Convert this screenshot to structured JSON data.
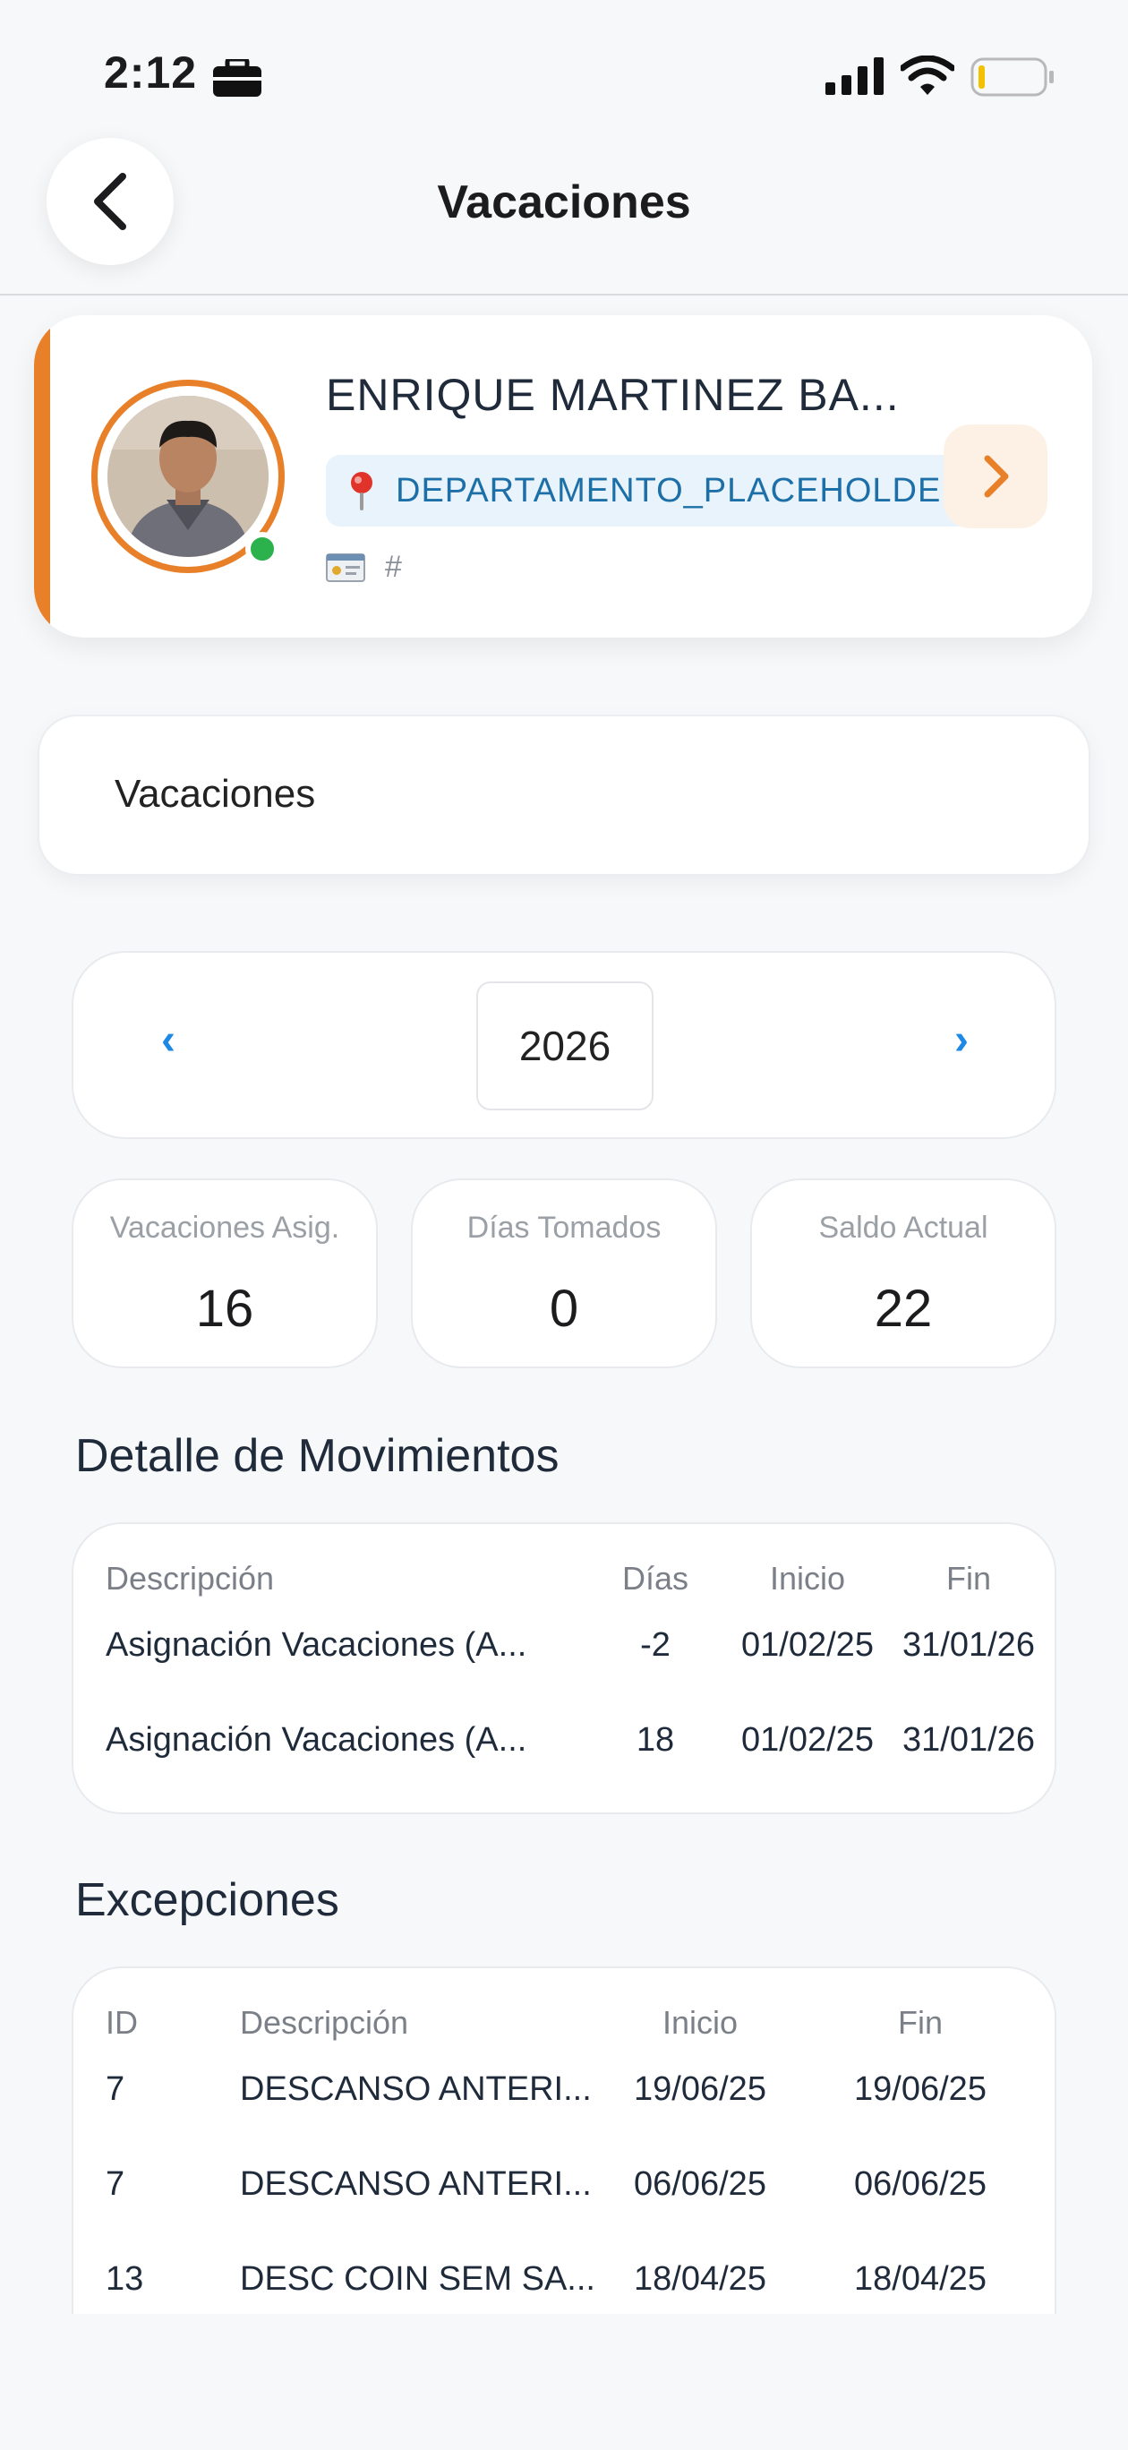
{
  "status_bar": {
    "time": "2:12"
  },
  "header": {
    "title": "Vacaciones"
  },
  "profile": {
    "name": "ENRIQUE MARTINEZ BA...",
    "department": "DEPARTAMENTO_PLACEHOLDER",
    "id_text": "#"
  },
  "section": {
    "label": "Vacaciones"
  },
  "year_selector": {
    "prev": "‹",
    "year": "2026",
    "next": "›"
  },
  "stats": [
    {
      "label": "Vacaciones Asig.",
      "value": "16"
    },
    {
      "label": "Días Tomados",
      "value": "0"
    },
    {
      "label": "Saldo Actual",
      "value": "22"
    }
  ],
  "movements": {
    "heading": "Detalle de Movimientos",
    "headers": {
      "descripcion": "Descripción",
      "dias": "Días",
      "inicio": "Inicio",
      "fin": "Fin"
    },
    "rows": [
      {
        "descripcion": "Asignación Vacaciones (A...",
        "dias": "-2",
        "inicio": "01/02/25",
        "fin": "31/01/26"
      },
      {
        "descripcion": "Asignación Vacaciones (A...",
        "dias": "18",
        "inicio": "01/02/25",
        "fin": "31/01/26"
      }
    ]
  },
  "exceptions": {
    "heading": "Excepciones",
    "headers": {
      "id": "ID",
      "descripcion": "Descripción",
      "inicio": "Inicio",
      "fin": "Fin"
    },
    "rows": [
      {
        "id": "7",
        "descripcion": "DESCANSO ANTERI...",
        "inicio": "19/06/25",
        "fin": "19/06/25"
      },
      {
        "id": "7",
        "descripcion": "DESCANSO ANTERI...",
        "inicio": "06/06/25",
        "fin": "06/06/25"
      },
      {
        "id": "13",
        "descripcion": "DESC COIN SEM SA...",
        "inicio": "18/04/25",
        "fin": "18/04/25"
      }
    ]
  },
  "colors": {
    "accent": "#e8802a",
    "link": "#1e88e5",
    "online": "#2bb24c",
    "badge_text": "#1d6fa8"
  }
}
